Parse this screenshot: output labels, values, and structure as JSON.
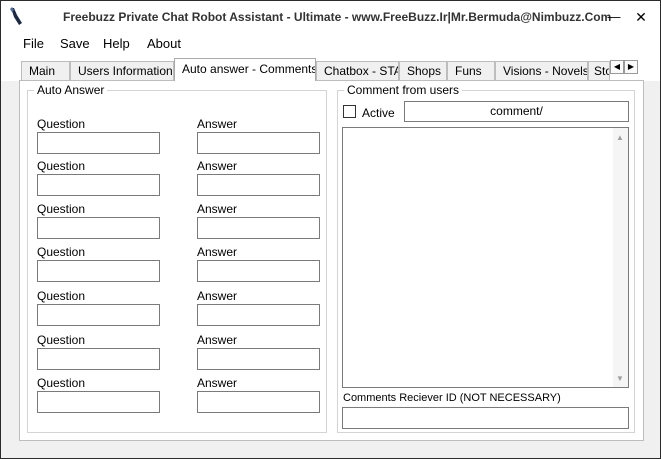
{
  "window": {
    "title": "Freebuzz  Private Chat Robot Assistant - Ultimate - www.FreeBuzz.Ir|Mr.Bermuda@Nimbuzz.Com",
    "minimize_glyph": "—",
    "close_glyph": "✕",
    "icon": "app-wrench-icon"
  },
  "menu": {
    "items": [
      {
        "label": "File"
      },
      {
        "label": "Save"
      },
      {
        "label": "Help"
      },
      {
        "label": "About"
      }
    ]
  },
  "tabs": {
    "items": [
      {
        "label": "Main"
      },
      {
        "label": "Users Information"
      },
      {
        "label": "Auto answer - Comments",
        "selected": true
      },
      {
        "label": "Chatbox - STA"
      },
      {
        "label": "Shops"
      },
      {
        "label": "Funs"
      },
      {
        "label": "Visions - Novels"
      },
      {
        "label": "Sto"
      }
    ],
    "scroll_left_glyph": "◀",
    "scroll_right_glyph": "▶"
  },
  "auto_answer": {
    "title": "Auto Answer",
    "question_label": "Question",
    "answer_label": "Answer",
    "rows": [
      {
        "question": "",
        "answer": ""
      },
      {
        "question": "",
        "answer": ""
      },
      {
        "question": "",
        "answer": ""
      },
      {
        "question": "",
        "answer": ""
      },
      {
        "question": "",
        "answer": ""
      },
      {
        "question": "",
        "answer": ""
      },
      {
        "question": "",
        "answer": ""
      }
    ]
  },
  "comments": {
    "title": "Comment from users",
    "active_label": "Active",
    "active_checked": false,
    "command_value": "comment/",
    "comment_text": "",
    "receiver_label": "Comments Reciever ID (NOT NECESSARY)",
    "receiver_value": ""
  }
}
